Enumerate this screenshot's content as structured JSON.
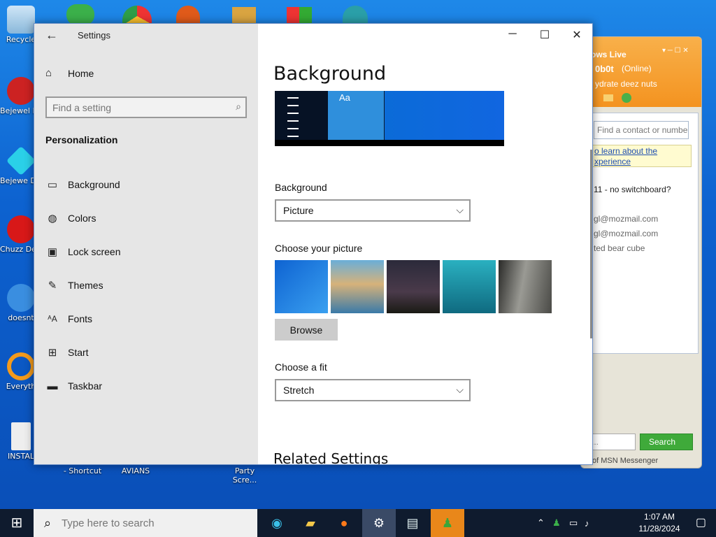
{
  "desktop": {
    "icons": [
      {
        "label": "Recycle"
      },
      {
        "label": "Bejewel Delux"
      },
      {
        "label": "Bejewe Delux"
      },
      {
        "label": "Chuzz Delux"
      },
      {
        "label": "doesnt"
      },
      {
        "label": "Everyth"
      },
      {
        "label": "INSTAL"
      }
    ],
    "bottom_labels": [
      "- Shortcut",
      "AVIANS",
      "Party Scre..."
    ]
  },
  "settings": {
    "window_title": "Settings",
    "home_label": "Home",
    "search_placeholder": "Find a setting",
    "section_title": "Personalization",
    "nav_items": [
      {
        "label": "Background",
        "icon": "picture-icon"
      },
      {
        "label": "Colors",
        "icon": "palette-icon"
      },
      {
        "label": "Lock screen",
        "icon": "lock-screen-icon"
      },
      {
        "label": "Themes",
        "icon": "brush-icon"
      },
      {
        "label": "Fonts",
        "icon": "fonts-icon"
      },
      {
        "label": "Start",
        "icon": "start-icon"
      },
      {
        "label": "Taskbar",
        "icon": "taskbar-icon"
      }
    ],
    "page_heading": "Background",
    "preview_text": "Aa",
    "background_label": "Background",
    "background_value": "Picture",
    "choose_picture_label": "Choose your picture",
    "browse_label": "Browse",
    "choose_fit_label": "Choose a fit",
    "fit_value": "Stretch",
    "related_heading": "Related Settings",
    "pictures": [
      {
        "name": "windows-blue",
        "color": "#1b7fe0"
      },
      {
        "name": "beach-rocks",
        "color": "#4a8fb8"
      },
      {
        "name": "night-sky-tent",
        "color": "#2a2430"
      },
      {
        "name": "underwater-swimmer",
        "color": "#1a8a9a"
      },
      {
        "name": "waterfall-cliff",
        "color": "#6a6a66"
      }
    ]
  },
  "msn": {
    "title": "ows Live",
    "user": "0b0t",
    "status": "(Online)",
    "personal_message": "ydrate deez nuts",
    "find_placeholder": "Find a contact or numbe",
    "notice": "o learn about the xperience",
    "lines": [
      "11 - no switchboard?",
      "gl@mozmail.com",
      "gl@mozmail.com",
      "ted bear cube"
    ],
    "search_label": "Search",
    "footer": "of MSN Messenger"
  },
  "taskbar": {
    "search_placeholder": "Type here to search",
    "time": "1:07 AM",
    "date": "11/28/2024"
  },
  "colors": {
    "accent": "#0078d7",
    "msn_orange": "#f49320",
    "msn_green": "#3faa3a"
  }
}
